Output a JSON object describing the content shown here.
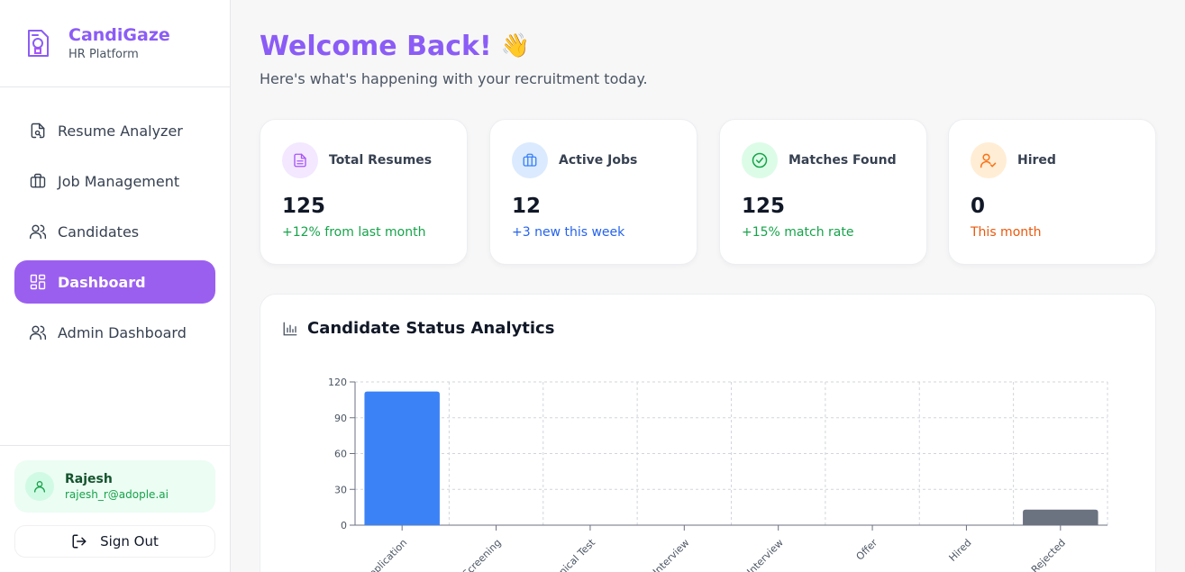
{
  "brand": {
    "name": "CandiGaze",
    "subtitle": "HR Platform"
  },
  "nav": [
    {
      "label": "Resume Analyzer",
      "icon": "file-search-icon",
      "active": false
    },
    {
      "label": "Job Management",
      "icon": "briefcase-icon",
      "active": false
    },
    {
      "label": "Candidates",
      "icon": "users-icon",
      "active": false
    },
    {
      "label": "Dashboard",
      "icon": "grid-icon",
      "active": true
    },
    {
      "label": "Admin Dashboard",
      "icon": "users-icon",
      "active": false
    }
  ],
  "user": {
    "name": "Rajesh",
    "email": "rajesh_r@adople.ai",
    "sign_out": "Sign Out"
  },
  "header": {
    "title": "Welcome Back!",
    "emoji": "👋",
    "subtitle": "Here's what's happening with your recruitment today."
  },
  "stats": [
    {
      "label": "Total Resumes",
      "value": "125",
      "note": "+12% from last month",
      "icon": "document-icon",
      "icon_bg": "#f3e8ff",
      "icon_color": "#a855f7",
      "note_color": "#16a34a"
    },
    {
      "label": "Active Jobs",
      "value": "12",
      "note": "+3 new this week",
      "icon": "briefcase-icon",
      "icon_bg": "#dbeafe",
      "icon_color": "#3b82f6",
      "note_color": "#2563eb"
    },
    {
      "label": "Matches Found",
      "value": "125",
      "note": "+15% match rate",
      "icon": "check-circle-icon",
      "icon_bg": "#dcfce7",
      "icon_color": "#16a34a",
      "note_color": "#16a34a"
    },
    {
      "label": "Hired",
      "value": "0",
      "note": "This month",
      "icon": "user-check-icon",
      "icon_bg": "#ffedd5",
      "icon_color": "#f97316",
      "note_color": "#ea580c"
    }
  ],
  "analytics": {
    "title": "Candidate Status Analytics"
  },
  "chart_data": {
    "type": "bar",
    "title": "Candidate Status Analytics",
    "categories": [
      "Application",
      "Screening",
      "Technical Test",
      "Interview",
      "Final Interview",
      "Offer",
      "Hired",
      "Rejected"
    ],
    "visible_tick_labels": [
      "pplication",
      "Screening",
      "hnical Test",
      "Interview",
      "l Interview",
      "Offer",
      "Hired",
      "Rejected"
    ],
    "values": [
      112,
      0,
      0,
      0,
      0,
      0,
      0,
      13
    ],
    "colors": [
      "#3b82f6",
      "#3b82f6",
      "#3b82f6",
      "#3b82f6",
      "#3b82f6",
      "#3b82f6",
      "#3b82f6",
      "#6b7280"
    ],
    "yticks": [
      0,
      30,
      60,
      90,
      120
    ],
    "ylim": [
      0,
      120
    ],
    "grid": true,
    "xlabel": "",
    "ylabel": ""
  }
}
